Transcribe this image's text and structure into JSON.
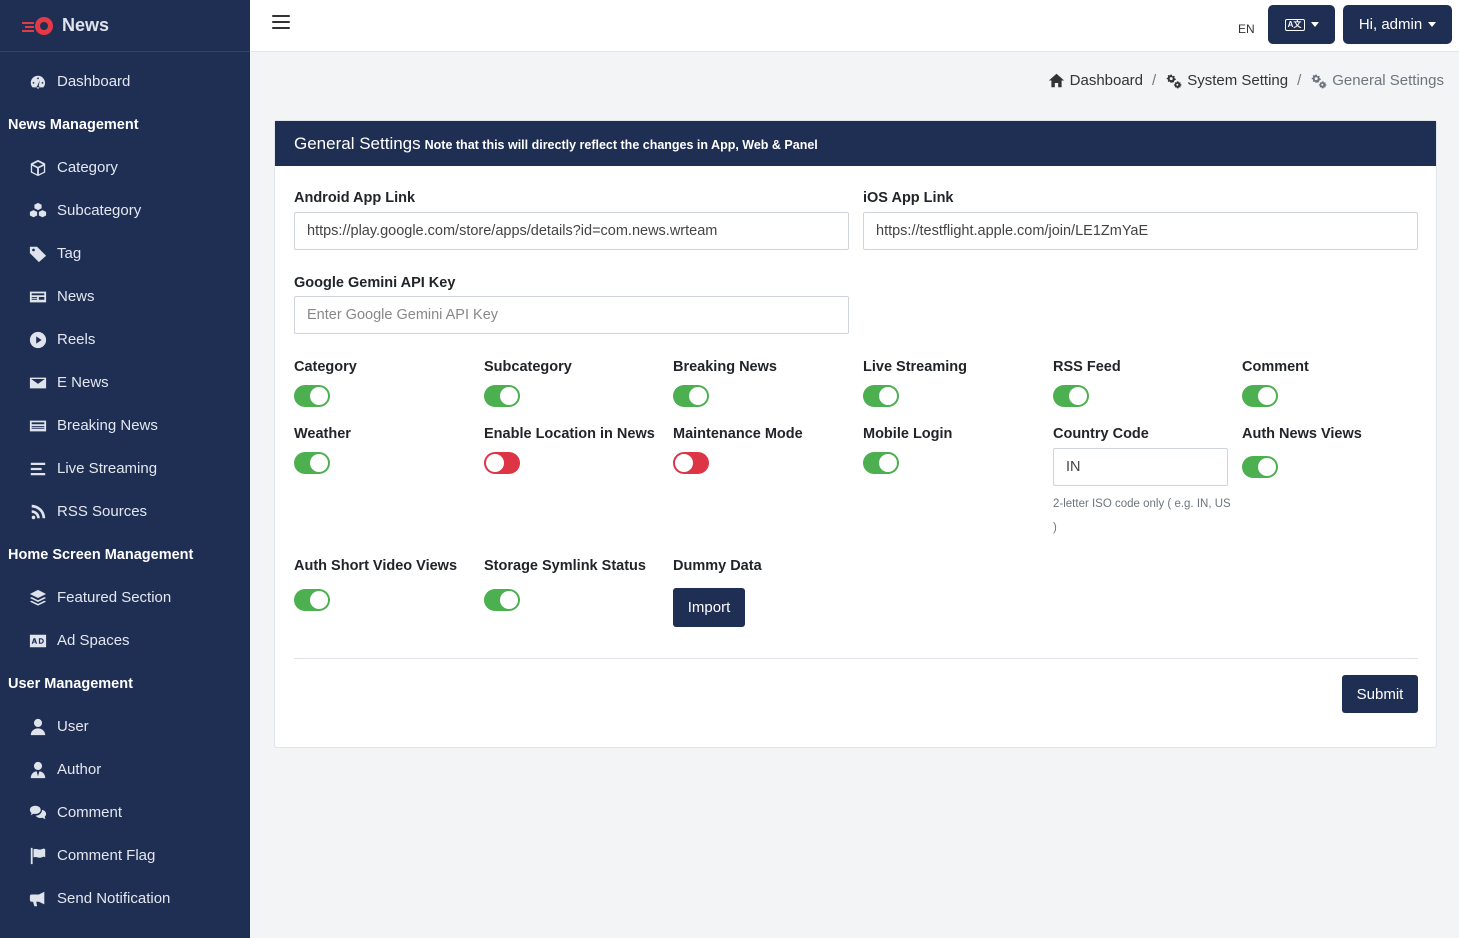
{
  "brand": {
    "name": "News"
  },
  "sidebar": {
    "items": [
      {
        "type": "item",
        "label": "Dashboard",
        "icon": "dashboard-icon"
      },
      {
        "type": "header",
        "label": "News Management"
      },
      {
        "type": "item",
        "label": "Category",
        "icon": "cube-icon"
      },
      {
        "type": "item",
        "label": "Subcategory",
        "icon": "cubes-icon"
      },
      {
        "type": "item",
        "label": "Tag",
        "icon": "tag-icon"
      },
      {
        "type": "item",
        "label": "News",
        "icon": "newspaper-icon"
      },
      {
        "type": "item",
        "label": "Reels",
        "icon": "play-circle-icon"
      },
      {
        "type": "item",
        "label": "E News",
        "icon": "envelope-icon"
      },
      {
        "type": "item",
        "label": "Breaking News",
        "icon": "newspaper-icon"
      },
      {
        "type": "item",
        "label": "Live Streaming",
        "icon": "stream-icon"
      },
      {
        "type": "item",
        "label": "RSS Sources",
        "icon": "rss-icon"
      },
      {
        "type": "header",
        "label": "Home Screen Management"
      },
      {
        "type": "item",
        "label": "Featured Section",
        "icon": "layers-icon"
      },
      {
        "type": "item",
        "label": "Ad Spaces",
        "icon": "ad-icon"
      },
      {
        "type": "header",
        "label": "User Management"
      },
      {
        "type": "item",
        "label": "User",
        "icon": "user-icon"
      },
      {
        "type": "item",
        "label": "Author",
        "icon": "user-tie-icon"
      },
      {
        "type": "item",
        "label": "Comment",
        "icon": "comments-icon"
      },
      {
        "type": "item",
        "label": "Comment Flag",
        "icon": "flag-icon"
      },
      {
        "type": "item",
        "label": "Send Notification",
        "icon": "bullhorn-icon"
      }
    ]
  },
  "topbar": {
    "lang_code": "EN",
    "lang_icon_text": "A文",
    "user_label": "Hi, admin"
  },
  "breadcrumb": {
    "dashboard": "Dashboard",
    "system_setting": "System Setting",
    "general_settings": "General Settings"
  },
  "card": {
    "title": "General Settings",
    "note": "Note that this will directly reflect the changes in App, Web & Panel"
  },
  "fields": {
    "android_label": "Android App Link",
    "android_value": "https://play.google.com/store/apps/details?id=com.news.wrteam",
    "ios_label": "iOS App Link",
    "ios_value": "https://testflight.apple.com/join/LE1ZmYaE",
    "gemini_label": "Google Gemini API Key",
    "gemini_placeholder": "Enter Google Gemini API Key",
    "country_label": "Country Code",
    "country_value": "IN",
    "country_help": "2-letter ISO code only ( e.g. IN, US )",
    "dummy_label": "Dummy Data",
    "import_label": "Import",
    "submit_label": "Submit"
  },
  "toggles": {
    "category": {
      "label": "Category",
      "on": true
    },
    "subcategory": {
      "label": "Subcategory",
      "on": true
    },
    "breaking_news": {
      "label": "Breaking News",
      "on": true
    },
    "live_streaming": {
      "label": "Live Streaming",
      "on": true
    },
    "rss_feed": {
      "label": "RSS Feed",
      "on": true
    },
    "comment": {
      "label": "Comment",
      "on": true
    },
    "weather": {
      "label": "Weather",
      "on": true
    },
    "enable_location": {
      "label": "Enable Location in News",
      "on": false
    },
    "maintenance_mode": {
      "label": "Maintenance Mode",
      "on": false
    },
    "mobile_login": {
      "label": "Mobile Login",
      "on": true
    },
    "auth_news_views": {
      "label": "Auth News Views",
      "on": true
    },
    "auth_short_video_views": {
      "label": "Auth Short Video Views",
      "on": true
    },
    "storage_symlink": {
      "label": "Storage Symlink Status",
      "on": true
    }
  },
  "colors": {
    "primary": "#1f2e53",
    "toggle_on": "#4caf50",
    "toggle_off": "#dc3545",
    "brand_red": "#e63946"
  }
}
